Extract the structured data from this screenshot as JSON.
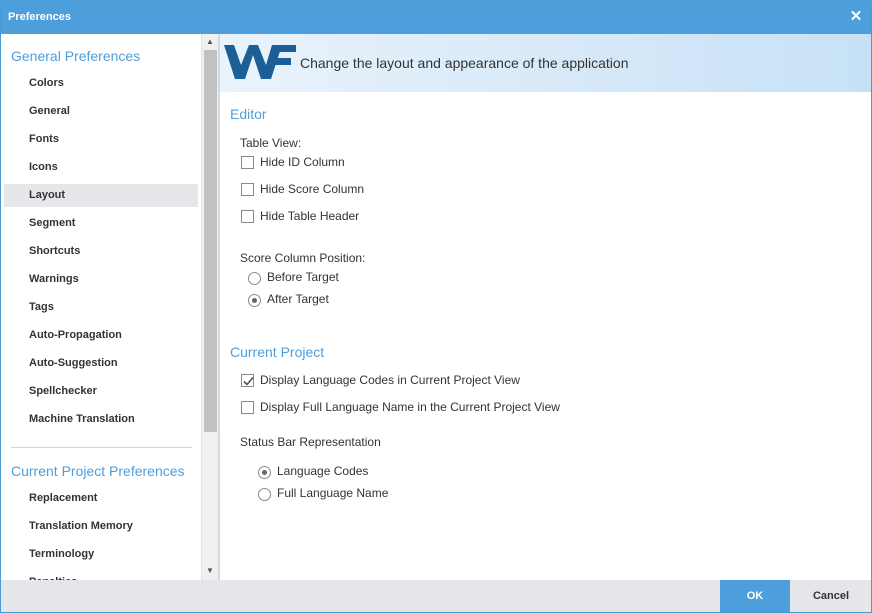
{
  "window": {
    "title": "Preferences",
    "close_icon": "close-icon"
  },
  "sidebar": {
    "general_title": "General Preferences",
    "general_items": [
      {
        "label": "Colors"
      },
      {
        "label": "General"
      },
      {
        "label": "Fonts"
      },
      {
        "label": "Icons"
      },
      {
        "label": "Layout",
        "active": true
      },
      {
        "label": "Segment"
      },
      {
        "label": "Shortcuts"
      },
      {
        "label": "Warnings"
      },
      {
        "label": "Tags"
      },
      {
        "label": "Auto-Propagation"
      },
      {
        "label": "Auto-Suggestion"
      },
      {
        "label": "Spellchecker"
      },
      {
        "label": "Machine Translation"
      }
    ],
    "project_title": "Current Project Preferences",
    "project_items": [
      {
        "label": "Replacement"
      },
      {
        "label": "Translation Memory"
      },
      {
        "label": "Terminology"
      },
      {
        "label": "Penalties"
      }
    ]
  },
  "banner": {
    "logo_text": "WF",
    "tagline": "Change the layout and appearance of the application"
  },
  "editor": {
    "heading": "Editor",
    "table_view_label": "Table View:",
    "hide_id_column": {
      "label": "Hide ID Column",
      "checked": false
    },
    "hide_score_column": {
      "label": "Hide Score Column",
      "checked": false
    },
    "hide_table_header": {
      "label": "Hide Table Header",
      "checked": false
    },
    "score_position_label": "Score Column Position:",
    "before_target": {
      "label": "Before Target",
      "selected": false
    },
    "after_target": {
      "label": "After Target",
      "selected": true
    }
  },
  "current_project": {
    "heading": "Current Project",
    "display_codes": {
      "label": "Display Language Codes in Current Project View",
      "checked": true
    },
    "display_full_name": {
      "label": "Display Full Language Name in the Current Project View",
      "checked": false
    },
    "status_bar_label": "Status Bar Representation",
    "language_codes": {
      "label": "Language Codes",
      "selected": true
    },
    "full_language_name": {
      "label": "Full Language Name",
      "selected": false
    }
  },
  "footer": {
    "ok_label": "OK",
    "cancel_label": "Cancel"
  },
  "colors": {
    "accent": "#4d9fdc",
    "active_item_bg": "#e5e7ea",
    "footer_bg": "#e4e6e9"
  }
}
